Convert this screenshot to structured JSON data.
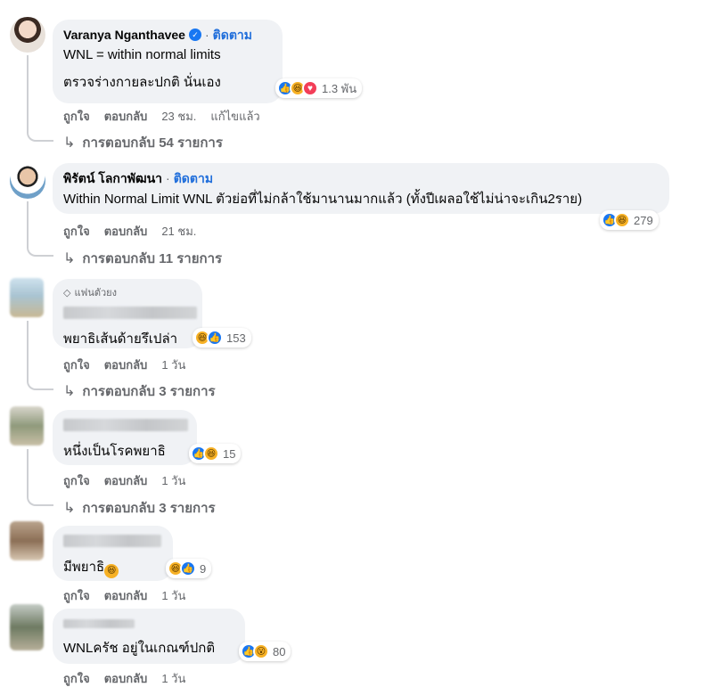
{
  "comments": [
    {
      "name": "Varanya Nganthavee",
      "follow": "ติดตาม",
      "dot": "·",
      "lines": [
        "WNL = within normal limits",
        "ตรวจร่างกายละปกติ นั่นเอง"
      ],
      "reaction_count": "1.3 พัน",
      "reactions": [
        "like-icon",
        "haha-icon",
        "love-icon"
      ],
      "like": "ถูกใจ",
      "reply": "ตอบกลับ",
      "time": "23 ชม.",
      "edited": "แก้ไขแล้ว",
      "replies_label": "การตอบกลับ 54 รายการ"
    },
    {
      "name": "พิรัตน์ โลกาพัฒนา",
      "follow": "ติดตาม",
      "dot": "·",
      "lines": [
        "Within Normal Limit WNL ตัวย่อที่ไม่กล้าใช้มานานมากแล้ว (ทั้งปีเผลอใช้ไม่น่าจะเกิน2ราย)"
      ],
      "reaction_count": "279",
      "reactions": [
        "like-icon",
        "haha-icon"
      ],
      "like": "ถูกใจ",
      "reply": "ตอบกลับ",
      "time": "21 ชม.",
      "replies_label": "การตอบกลับ 11 รายการ"
    },
    {
      "badge": "แฟนตัวยง",
      "lines": [
        "พยาธิเส้นด้ายรึเปล่า"
      ],
      "reaction_count": "153",
      "reactions": [
        "haha-icon",
        "like-icon"
      ],
      "like": "ถูกใจ",
      "reply": "ตอบกลับ",
      "time": "1 วัน",
      "replies_label": "การตอบกลับ 3 รายการ"
    },
    {
      "lines": [
        "หนึ่งเป็นโรคพยาธิ"
      ],
      "reaction_count": "15",
      "reactions": [
        "like-icon",
        "haha-icon"
      ],
      "like": "ถูกใจ",
      "reply": "ตอบกลับ",
      "time": "1 วัน",
      "replies_label": "การตอบกลับ 3 รายการ"
    },
    {
      "lines": [
        "มีพยาธิ"
      ],
      "reaction_count": "9",
      "reactions": [
        "haha-icon",
        "like-icon"
      ],
      "like": "ถูกใจ",
      "reply": "ตอบกลับ",
      "time": "1 วัน"
    },
    {
      "lines": [
        "WNLครัช อยู่ในเกณฑ์ปกติ"
      ],
      "reaction_count": "80",
      "reactions": [
        "like-icon",
        "wow-icon"
      ],
      "like": "ถูกใจ",
      "reply": "ตอบกลับ",
      "time": "1 วัน"
    }
  ],
  "colors": {
    "bubble": "#f0f2f5",
    "link": "#216fdb",
    "meta": "#65676b",
    "like": "#1877f2",
    "haha": "#f7b125",
    "love": "#f33e58"
  }
}
